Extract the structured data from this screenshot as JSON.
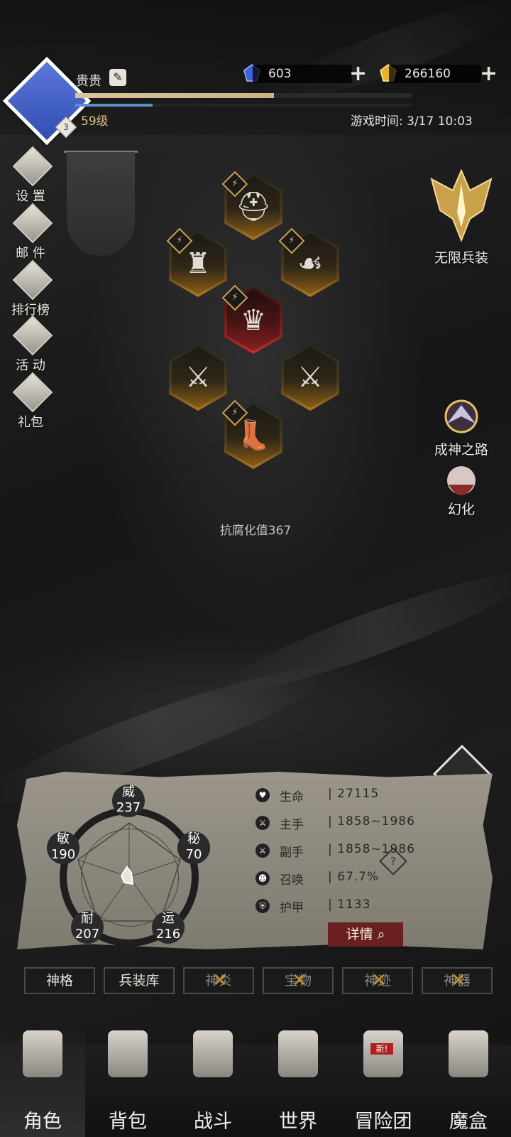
{
  "player": {
    "name": "贵贵",
    "level_text": "59级",
    "badge": "3",
    "exp_fraction": 0.59,
    "mp_fraction": 0.23
  },
  "currencies": [
    {
      "icon": "blue-crystal-icon",
      "value": "603"
    },
    {
      "icon": "gold-crystal-icon",
      "value": "266160"
    }
  ],
  "game_time": "游戏时间: 3/17 10:03",
  "left_menu": [
    {
      "label": "设 置",
      "icon": "gear-icon"
    },
    {
      "label": "邮 件",
      "icon": "mail-icon"
    },
    {
      "label": "排行榜",
      "icon": "ranking-icon"
    },
    {
      "label": "活 动",
      "icon": "event-icon"
    },
    {
      "label": "礼包",
      "icon": "gift-icon"
    }
  ],
  "right_menu": [
    {
      "label": "无限兵装",
      "icon": "infinite-arms-icon"
    },
    {
      "label": "成神之路",
      "icon": "godhood-path-icon"
    },
    {
      "label": "幻化",
      "icon": "transmog-icon"
    }
  ],
  "equipment": [
    {
      "slot": "helmet",
      "icon": "helmet-icon"
    },
    {
      "slot": "shoulder",
      "icon": "shoulder-armor-icon"
    },
    {
      "slot": "amulet",
      "icon": "amulet-icon"
    },
    {
      "slot": "chest",
      "icon": "chest-armor-icon"
    },
    {
      "slot": "main-weapon",
      "icon": "sword-icon"
    },
    {
      "slot": "off-weapon",
      "icon": "sword-icon"
    },
    {
      "slot": "boots",
      "icon": "boots-icon"
    }
  ],
  "corruption_text": "抗腐化值367",
  "stats": {
    "wei": {
      "name": "威",
      "value": "237"
    },
    "mi": {
      "name": "秘",
      "value": "70"
    },
    "yun": {
      "name": "运",
      "value": "216"
    },
    "nai": {
      "name": "耐",
      "value": "207"
    },
    "min": {
      "name": "敏",
      "value": "190"
    }
  },
  "attributes": [
    {
      "icon": "heart-icon",
      "name": "生命",
      "value": "| 27115"
    },
    {
      "icon": "main-hand-icon",
      "name": "主手",
      "value": "| 1858~1986"
    },
    {
      "icon": "off-hand-icon",
      "name": "副手",
      "value": "| 1858~1986"
    },
    {
      "icon": "summon-icon",
      "name": "召唤",
      "value": "| 67.7%"
    },
    {
      "icon": "armor-icon",
      "name": "护甲",
      "value": "| 1133"
    }
  ],
  "detail_label": "详情",
  "tabs": [
    {
      "label": "神格",
      "locked": false
    },
    {
      "label": "兵装库",
      "locked": false
    },
    {
      "label": "神炎",
      "locked": true
    },
    {
      "label": "宝物",
      "locked": true
    },
    {
      "label": "神迹",
      "locked": true
    },
    {
      "label": "神器",
      "locked": true
    }
  ],
  "bottom_nav": [
    {
      "label": "角色",
      "active": true
    },
    {
      "label": "背包",
      "active": false
    },
    {
      "label": "战斗",
      "active": false
    },
    {
      "label": "世界",
      "active": false
    },
    {
      "label": "冒险团",
      "active": false,
      "badge": "新!"
    },
    {
      "label": "魔盒",
      "active": false
    }
  ],
  "colors": {
    "accent_gold": "#d9c288",
    "detail_red": "#6b2020",
    "hex_gold": "#b07a22",
    "hex_red": "#c23030"
  }
}
